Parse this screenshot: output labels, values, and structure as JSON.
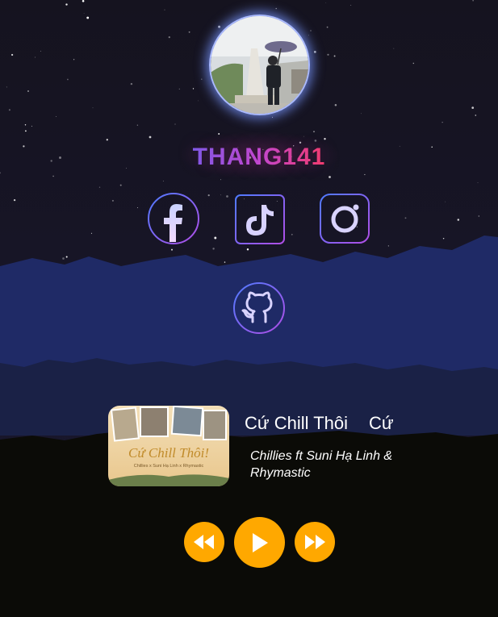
{
  "profile": {
    "name": "THANG141",
    "avatar_alt": "profile photo"
  },
  "socials": [
    {
      "name": "facebook-icon"
    },
    {
      "name": "tiktok-icon"
    },
    {
      "name": "instagram-icon"
    },
    {
      "name": "github-icon"
    }
  ],
  "player": {
    "cover_title": "Cứ Chill Thôi!",
    "cover_artists": "Chillies x Suni Hạ Linh x Rhymastic",
    "song_title": "Cứ Chill Thôi",
    "song_title_repeat": "Cứ",
    "artist": "Chillies ft Suni Hạ Linh & Rhymastic",
    "controls": {
      "prev": "rewind-icon",
      "play": "play-icon",
      "next": "fast-forward-icon"
    }
  },
  "colors": {
    "accent": "#ffa800",
    "social_stroke": "#8b5cf6",
    "mountain_front": "#1f2a66",
    "sky": "#15131f"
  }
}
